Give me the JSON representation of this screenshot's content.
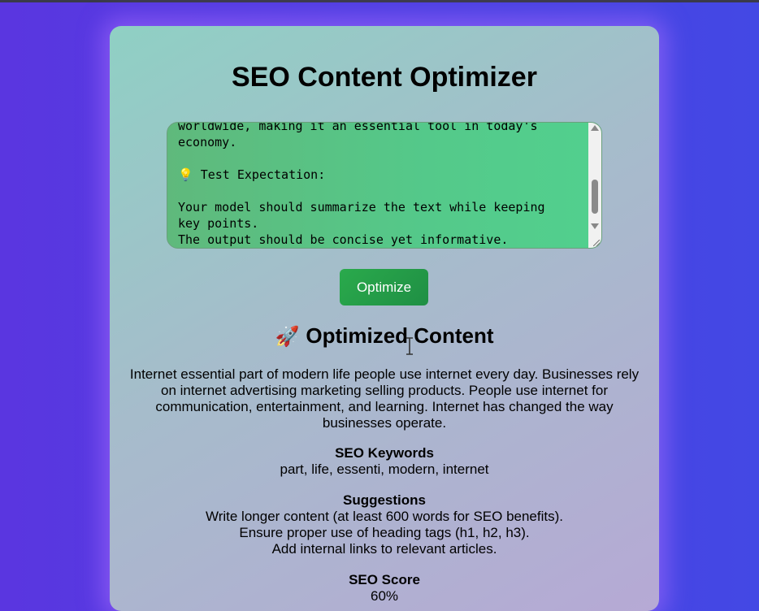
{
  "page": {
    "title": "SEO Content Optimizer"
  },
  "editor": {
    "text": "worldwide, making it an essential tool in today's\neconomy.\n\n💡 Test Expectation:\n\nYour model should summarize the text while keeping\nkey points.\nThe output should be concise yet informative."
  },
  "actions": {
    "optimize_label": "Optimize"
  },
  "result": {
    "heading": "Optimized Content",
    "heading_icon": "🚀",
    "summary": "Internet essential part of modern life people use internet every day. Businesses rely on internet advertising marketing selling products. People use internet for communication, entertainment, and learning. Internet has changed the way businesses operate.",
    "keywords_label": "SEO Keywords",
    "keywords": "part, life, essenti, modern, internet",
    "suggestions_label": "Suggestions",
    "suggestions": [
      "Write longer content (at least 600 words for SEO benefits).",
      "Ensure proper use of heading tags (h1, h2, h3).",
      "Add internal links to relevant articles."
    ],
    "score_label": "SEO Score",
    "score": "60%"
  },
  "colors": {
    "button": "#23a04a",
    "textarea_bg": "#56c787",
    "page_bg": "#5040e2"
  }
}
